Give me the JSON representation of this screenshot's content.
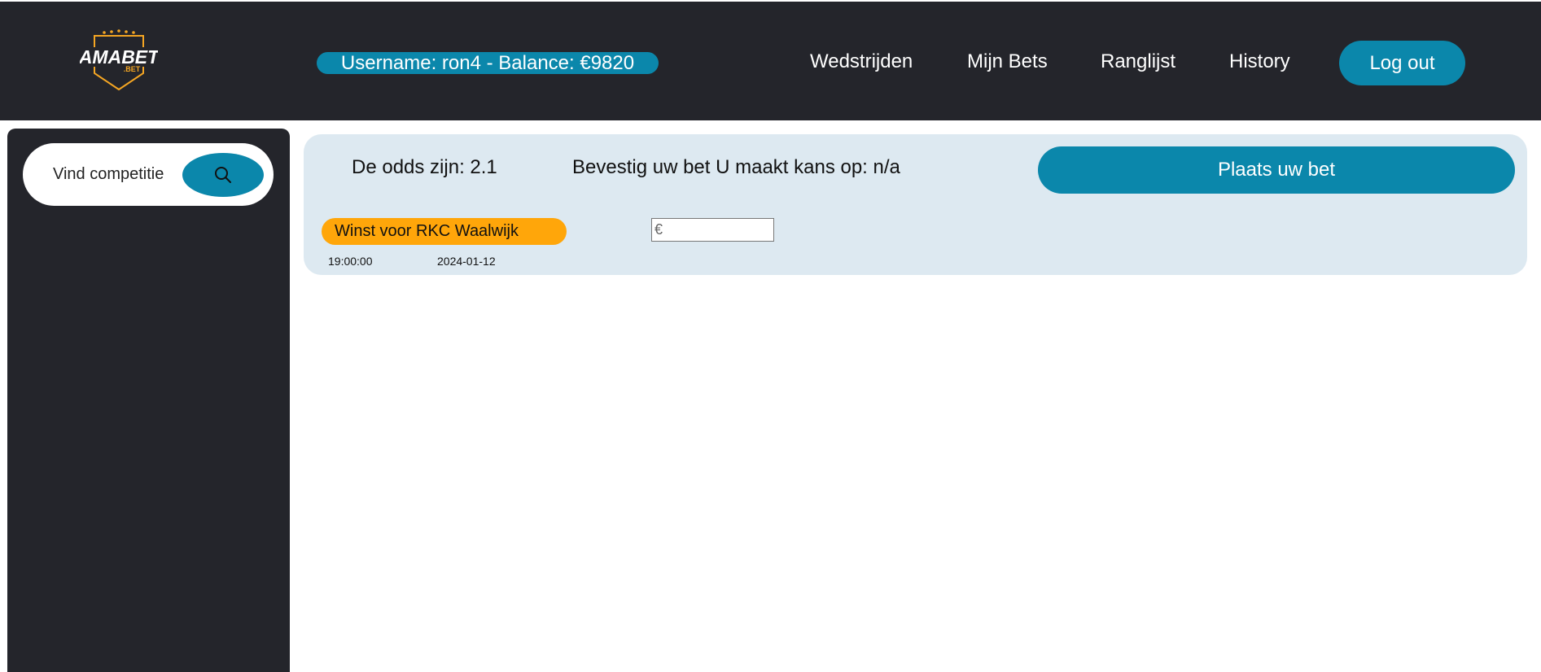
{
  "header": {
    "logo": {
      "text": "AMABET",
      "subtext": ".BET",
      "accent": "#f5a623"
    },
    "user_status": "Username: ron4 - Balance: €9820",
    "nav": [
      "Wedstrijden",
      "Mijn Bets",
      "Ranglijst",
      "History"
    ],
    "logout_label": "Log out"
  },
  "sidebar": {
    "search_label": "Vind competitie",
    "search_icon": "search-icon"
  },
  "bet": {
    "odds_text": "De odds zijn: 2.1",
    "confirm_text": "Bevestig uw bet U maakt kans op: n/a",
    "place_label": "Plaats uw bet",
    "outcome_label": "Winst voor RKC Waalwijk",
    "amount_placeholder": "€",
    "time": "19:00:00",
    "date": "2024-01-12"
  },
  "colors": {
    "header_bg": "#24252b",
    "accent": "#0b87ab",
    "outcome": "#ffa60a",
    "card_bg": "#dde9f1"
  }
}
